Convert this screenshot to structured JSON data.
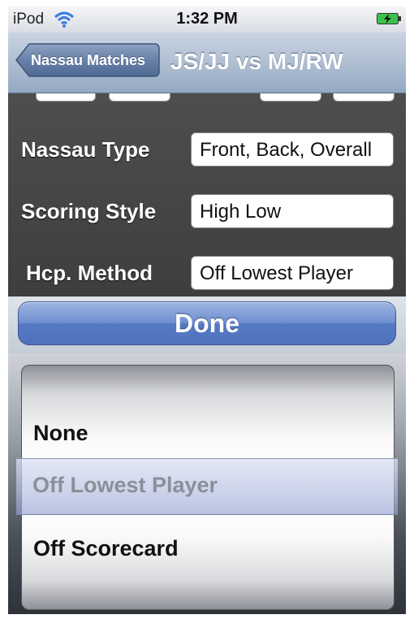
{
  "status": {
    "carrier": "iPod",
    "time": "1:32 PM"
  },
  "navbar": {
    "back_label": "Nassau Matches",
    "title": "JS/JJ vs MJ/RW"
  },
  "form": {
    "rows": [
      {
        "label": "Nassau Type",
        "value": "Front, Back, Overall"
      },
      {
        "label": "Scoring Style",
        "value": "High Low"
      },
      {
        "label": "Hcp. Method",
        "value": "Off Lowest Player"
      }
    ]
  },
  "done_label": "Done",
  "picker": {
    "options": [
      "None",
      "Off Lowest Player",
      "Off Scorecard"
    ],
    "selected": "Off Lowest Player"
  }
}
